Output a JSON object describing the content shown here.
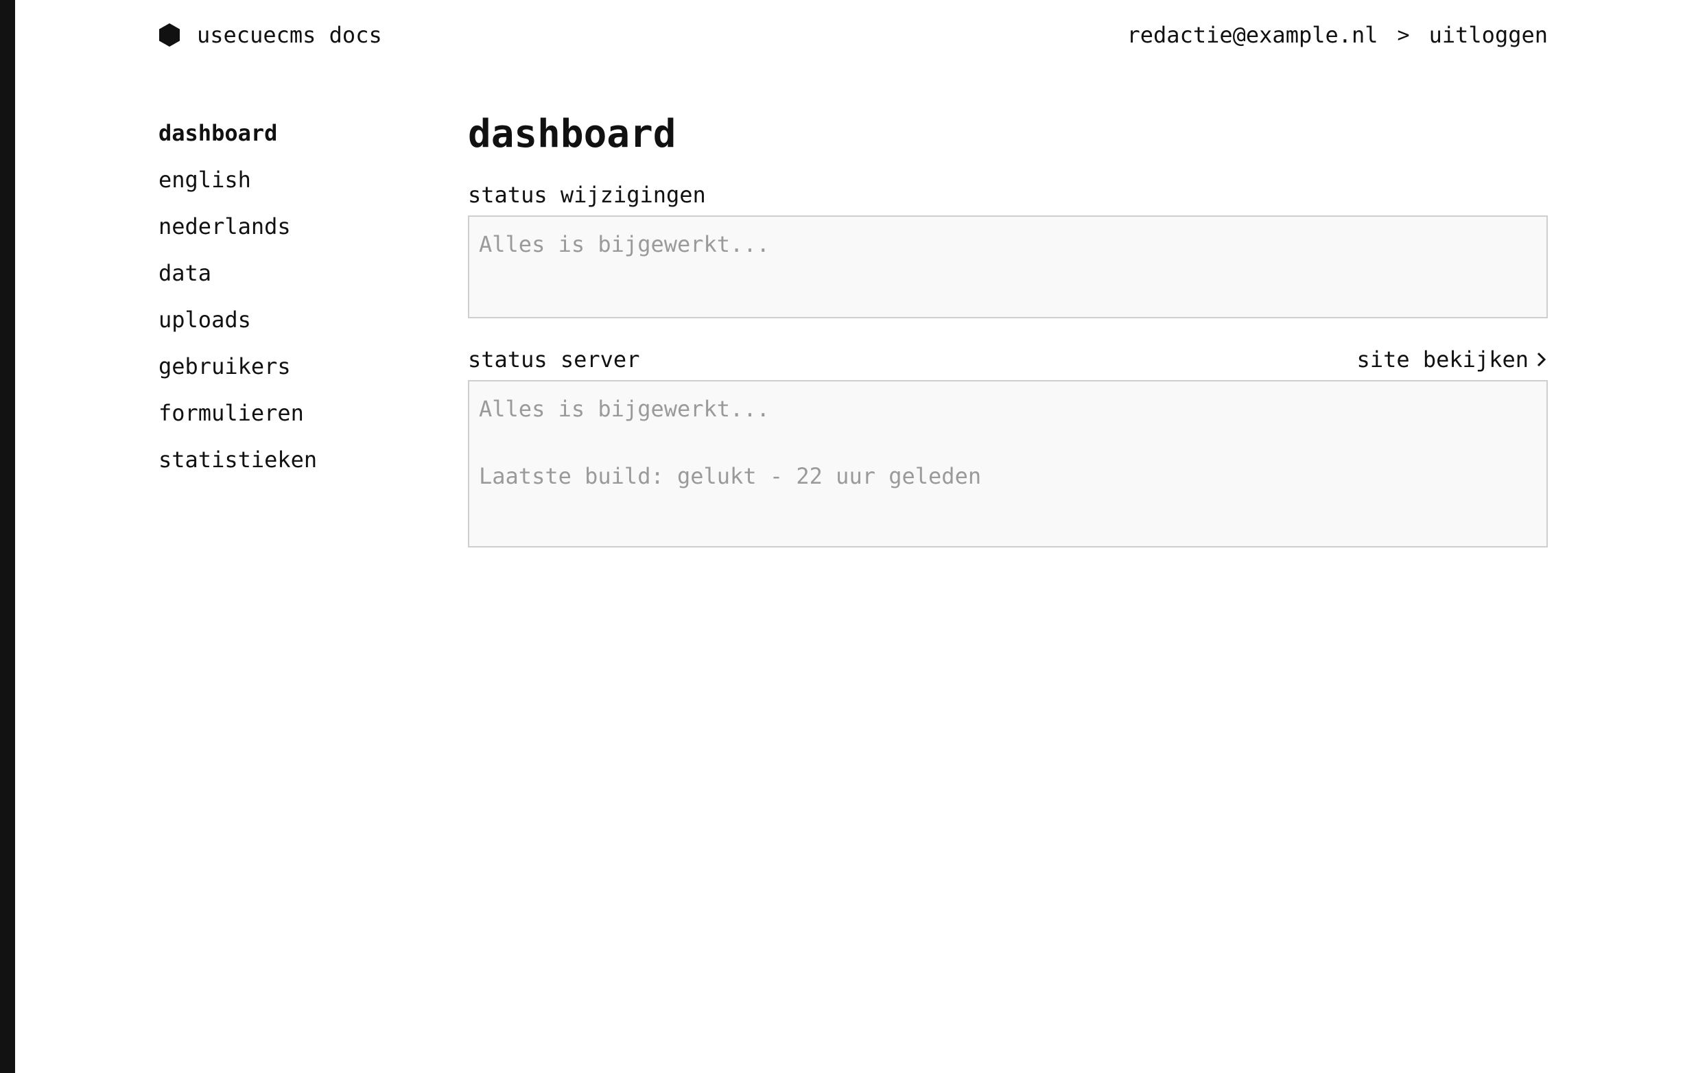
{
  "brand": {
    "name": "usecuecms docs",
    "icon": "hexagon-logo-icon"
  },
  "user": {
    "email": "redactie@example.nl",
    "separator_icon": "chevron-right-icon",
    "logout_label": "uitloggen"
  },
  "sidebar": {
    "items": [
      {
        "label": "dashboard",
        "active": true
      },
      {
        "label": "english"
      },
      {
        "label": "nederlands"
      },
      {
        "label": "data"
      },
      {
        "label": "uploads"
      },
      {
        "label": "gebruikers"
      },
      {
        "label": "formulieren"
      },
      {
        "label": "statistieken"
      }
    ]
  },
  "main": {
    "title": "dashboard",
    "changes": {
      "heading": "status wijzigingen",
      "message": "Alles is bijgewerkt..."
    },
    "server": {
      "heading": "status server",
      "view_site_label": "site bekijken",
      "message": "Alles is bijgewerkt...",
      "build_status": "Laatste build: gelukt - 22 uur geleden"
    }
  },
  "colors": {
    "strip": "#121212",
    "text": "#111111",
    "muted": "#9a9a9a",
    "box_bg": "#f9f9f9",
    "box_border": "#cfcfcf"
  }
}
